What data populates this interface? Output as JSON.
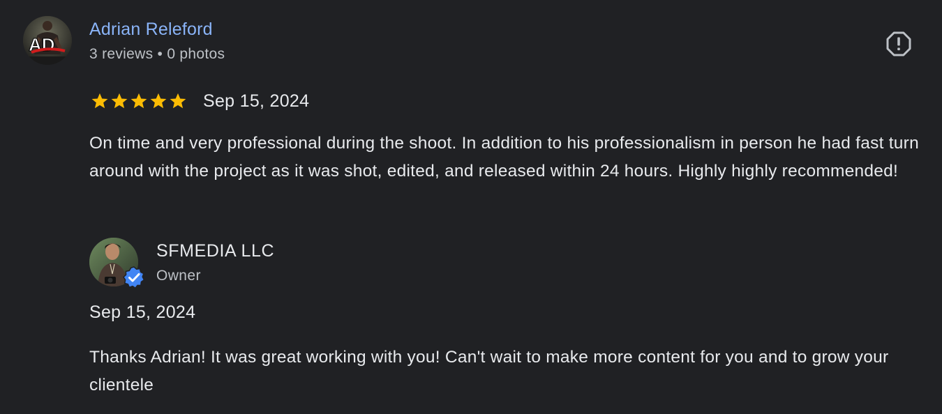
{
  "review": {
    "reviewer": {
      "name": "Adrian Releford",
      "meta": "3 reviews • 0 photos",
      "avatar_icon": "profile-photo",
      "avatar_text": "AD"
    },
    "report_icon": "flag-report-icon",
    "rating": {
      "stars": 5,
      "max": 5,
      "star_color": "#fbbc04"
    },
    "date": "Sep 15, 2024",
    "text": "On time and very professional during the shoot. In addition to his professionalism in person he had fast turn around with the project as it was shot, edited, and released within 24 hours. Highly highly recommended!"
  },
  "owner_response": {
    "name": "SFMEDIA LLC",
    "role": "Owner",
    "verified_icon": "verified-check-icon",
    "verified_color": "#4285f4",
    "date": "Sep 15, 2024",
    "text": "Thanks Adrian! It was great working with you! Can't wait to make more content for you and to grow your clientele"
  },
  "colors": {
    "background": "#202124",
    "link": "#8ab4f8",
    "primary_text": "#e8eaed",
    "secondary_text": "#bdc1c6"
  }
}
